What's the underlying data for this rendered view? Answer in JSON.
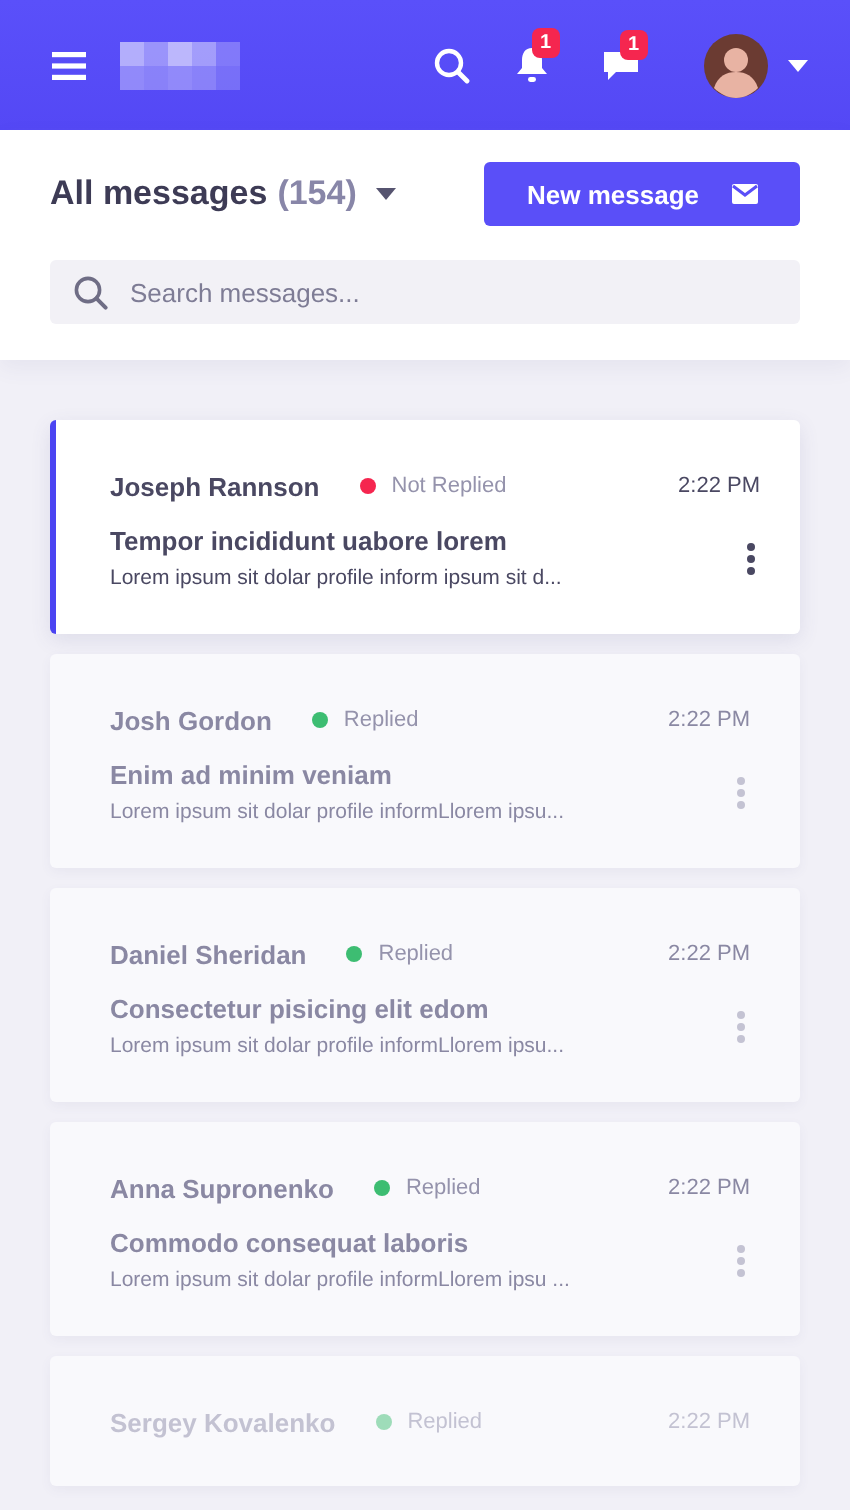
{
  "topbar": {
    "notifications_badge": "1",
    "messages_badge": "1"
  },
  "header": {
    "title": "All messages",
    "count": "(154)",
    "new_button": "New message",
    "search": {
      "placeholder": "Search messages..."
    }
  },
  "messages": [
    {
      "name": "Joseph Rannson",
      "status": "Not Replied",
      "color": "#f5264f",
      "time": "2:22 PM",
      "subject": "Tempor incididunt uabore lorem",
      "preview": "Lorem ipsum sit dolar profile inform ipsum sit d...",
      "selected": true
    },
    {
      "name": "Josh Gordon",
      "status": "Replied",
      "color": "#3dbd72",
      "time": "2:22 PM",
      "subject": "Enim ad minim veniam",
      "preview": "Lorem ipsum sit dolar profile informLlorem ipsu...",
      "selected": false
    },
    {
      "name": "Daniel Sheridan",
      "status": "Replied",
      "color": "#3dbd72",
      "time": "2:22 PM",
      "subject": "Consectetur pisicing elit edom",
      "preview": "Lorem ipsum sit dolar profile informLlorem ipsu...",
      "selected": false
    },
    {
      "name": "Anna Supronenko",
      "status": "Replied",
      "color": "#3dbd72",
      "time": "2:22 PM",
      "subject": "Commodo consequat laboris",
      "preview": "Lorem ipsum sit dolar profile informLlorem ipsu ...",
      "selected": false
    },
    {
      "name": "Sergey Kovalenko",
      "status": "Replied",
      "color": "#9edcb9",
      "time": "2:22 PM",
      "selected": false
    }
  ]
}
